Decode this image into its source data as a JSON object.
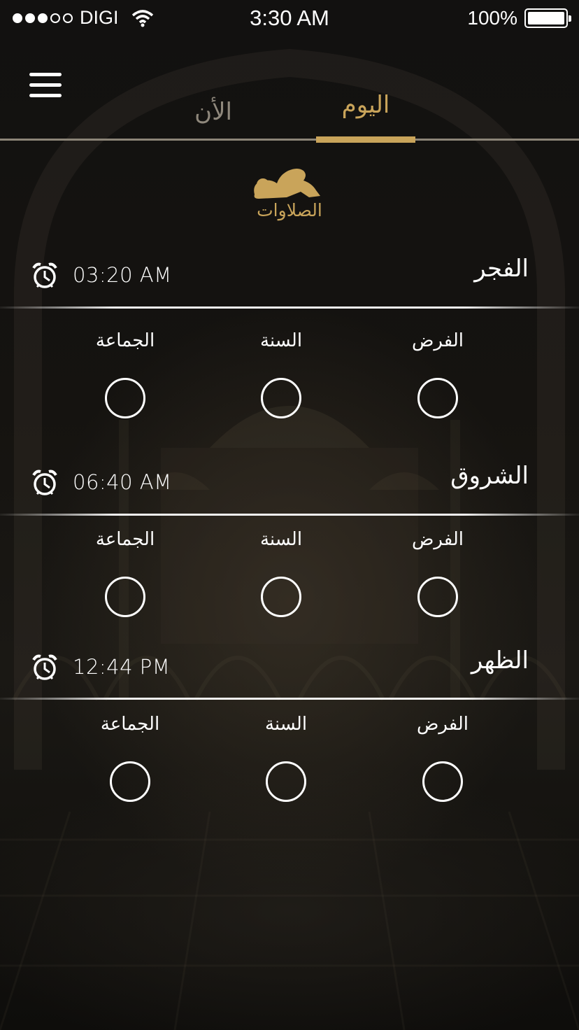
{
  "status_bar": {
    "carrier": "DIGI",
    "time": "3:30 AM",
    "battery": "100%",
    "signal_filled": 3,
    "signal_total": 5
  },
  "header": {
    "menu_icon": "hamburger-icon",
    "tabs": [
      {
        "label": "الأن",
        "active": false
      },
      {
        "label": "اليوم",
        "active": true
      }
    ]
  },
  "section": {
    "icon": "prayer-prostration-icon",
    "title": "الصلاوات"
  },
  "prayers": [
    {
      "name": "الفجر",
      "time": "03:20 AM",
      "options": [
        {
          "label": "الفرض",
          "checked": false
        },
        {
          "label": "السنة",
          "checked": false
        },
        {
          "label": "الجماعة",
          "checked": false
        }
      ]
    },
    {
      "name": "الشروق",
      "time": "06:40 AM",
      "options": [
        {
          "label": "الفرض",
          "checked": false
        },
        {
          "label": "السنة",
          "checked": false
        },
        {
          "label": "الجماعة",
          "checked": false
        }
      ]
    },
    {
      "name": "الظهر",
      "time": "12:44 PM",
      "options": [
        {
          "label": "الفرض",
          "checked": false
        },
        {
          "label": "السنة",
          "checked": false
        },
        {
          "label": "الجماعة",
          "checked": false
        }
      ]
    }
  ],
  "colors": {
    "accent": "#c9a45a",
    "inactive_tab": "#8f887c",
    "text": "#ffffff",
    "background": "#121110"
  }
}
